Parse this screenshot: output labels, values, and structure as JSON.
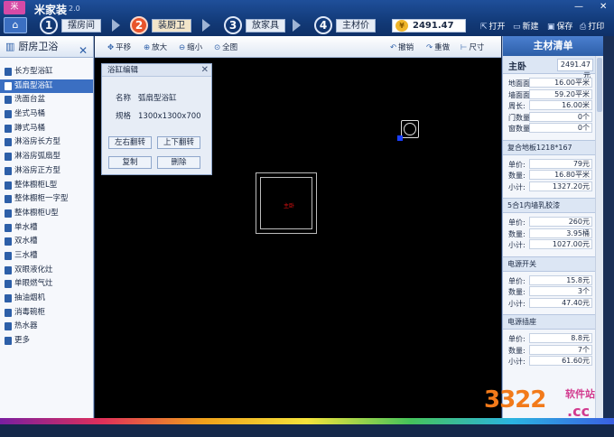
{
  "app": {
    "logo": "米",
    "title": "米家装",
    "version": "2.0"
  },
  "steps": [
    {
      "num": "1",
      "label": "摆房间"
    },
    {
      "num": "2",
      "label": "装厨卫"
    },
    {
      "num": "3",
      "label": "放家具"
    },
    {
      "num": "4",
      "label": "主材价"
    }
  ],
  "total_price": "2491.47",
  "top_actions": {
    "open": "打开",
    "new": "新建",
    "save": "保存",
    "print": "打印"
  },
  "left_panel": {
    "title": "厨房卫浴",
    "items": [
      "长方型浴缸",
      "弧扇型浴缸",
      "洗面台盆",
      "坐式马桶",
      "蹲式马桶",
      "淋浴房长方型",
      "淋浴房弧扇型",
      "淋浴房正方型",
      "整体橱柜L型",
      "整体橱柜一字型",
      "整体橱柜U型",
      "单水槽",
      "双水槽",
      "三水槽",
      "双眼液化灶",
      "单眼燃气灶",
      "抽油烟机",
      "消毒碗柜",
      "热水器",
      "更多"
    ]
  },
  "toolbar": {
    "pan": "平移",
    "zoom_in": "放大",
    "zoom_out": "缩小",
    "full": "全图",
    "undo": "撤销",
    "redo": "重做",
    "dimension": "尺寸"
  },
  "dialog": {
    "title": "浴缸编辑",
    "name_label": "名称",
    "name_value": "弧扇型浴缸",
    "spec_label": "规格",
    "spec_value": "1300x1300x700",
    "flip_h": "左右翻转",
    "flip_v": "上下翻转",
    "copy": "复制",
    "delete": "删除"
  },
  "canvas": {
    "room_label": "主卧"
  },
  "right_panel": {
    "title": "主材清单",
    "room": {
      "name": "主卧",
      "price": "2491.47元"
    },
    "room_stats": [
      {
        "k": "地面面积:",
        "v": "16.00平米"
      },
      {
        "k": "墙面面积:",
        "v": "59.20平米"
      },
      {
        "k": "周长:",
        "v": "16.00米"
      },
      {
        "k": "门数量:",
        "v": "0个"
      },
      {
        "k": "窗数量:",
        "v": "0个"
      }
    ],
    "sections": [
      {
        "title": "复合地板1218*167",
        "rows": [
          {
            "k": "单价:",
            "v": "79元"
          },
          {
            "k": "数量:",
            "v": "16.80平米"
          },
          {
            "k": "小计:",
            "v": "1327.20元"
          }
        ]
      },
      {
        "title": "5合1内墙乳胶漆",
        "rows": [
          {
            "k": "单价:",
            "v": "260元"
          },
          {
            "k": "数量:",
            "v": "3.95桶"
          },
          {
            "k": "小计:",
            "v": "1027.00元"
          }
        ]
      },
      {
        "title": "电源开关",
        "rows": [
          {
            "k": "单价:",
            "v": "15.8元"
          },
          {
            "k": "数量:",
            "v": "3个"
          },
          {
            "k": "小计:",
            "v": "47.40元"
          }
        ]
      },
      {
        "title": "电源插座",
        "rows": [
          {
            "k": "单价:",
            "v": "8.8元"
          },
          {
            "k": "数量:",
            "v": "7个"
          },
          {
            "k": "小计:",
            "v": "61.60元"
          }
        ]
      }
    ]
  },
  "watermark": {
    "logo": "3322",
    "site": "软件站",
    "tld": ".cc"
  }
}
